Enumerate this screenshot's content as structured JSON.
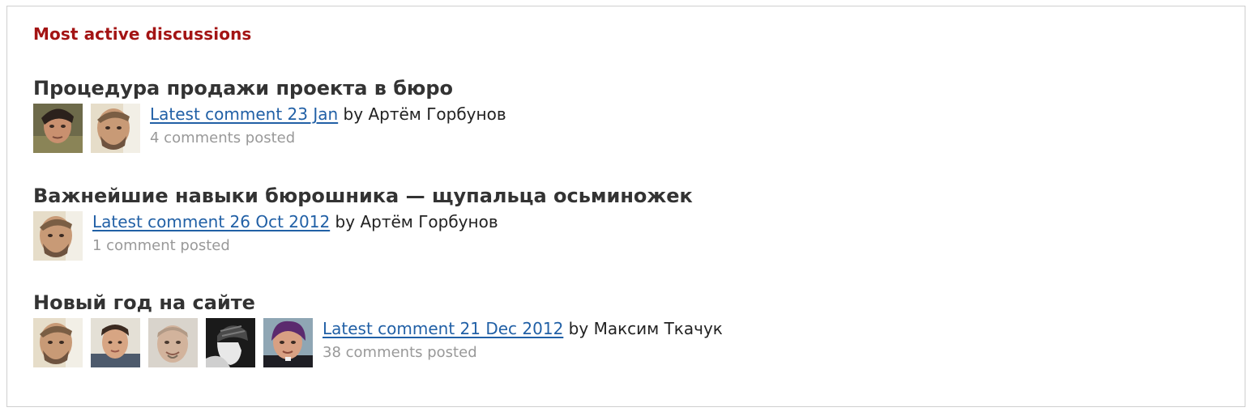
{
  "panel": {
    "title": "Most active discussions"
  },
  "discussions": [
    {
      "title": "Процедура продажи проекта в бюро",
      "latest_label": "Latest comment 23 Jan",
      "by_prefix": "by",
      "author": "Артём Горбунов",
      "count": "4 comments posted",
      "avatars": [
        "avatar-man-dark-hair",
        "avatar-man-beard"
      ]
    },
    {
      "title": "Важнейшие навыки бюрошника — щупальца осьминожек",
      "latest_label": "Latest comment 26 Oct 2012",
      "by_prefix": "by",
      "author": "Артём Горбунов",
      "count": "1 comment posted",
      "avatars": [
        "avatar-man-beard"
      ]
    },
    {
      "title": "Новый год на сайте",
      "latest_label": "Latest comment 21 Dec 2012",
      "by_prefix": "by",
      "author": "Максим Ткачук",
      "count": "38 comments posted",
      "avatars": [
        "avatar-man-beard",
        "avatar-young-man",
        "avatar-bald-man",
        "avatar-bw-hat",
        "avatar-man-purple"
      ]
    }
  ]
}
